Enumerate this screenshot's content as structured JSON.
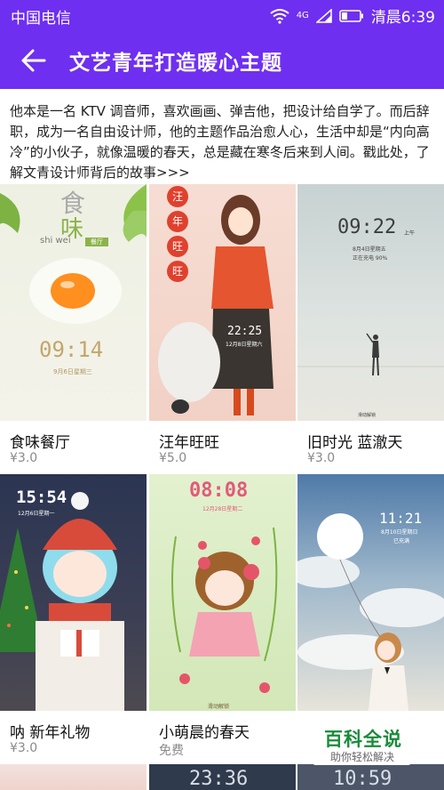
{
  "status_bar": {
    "carrier": "中国电信",
    "network": "4G",
    "time": "清晨6:39"
  },
  "header": {
    "title": "文艺青年打造暖心主题"
  },
  "description": "他本是一名 KTV 调音师，喜欢画画、弹吉他，把设计给自学了。而后辞职，成为一名自由设计师，他的主题作品治愈人心，生活中却是“内向高冷”的小伙子，就像温暖的春天，总是藏在寒冬后来到人间。戳此处，了解文青设计师背后的故事>>>",
  "themes": [
    {
      "name": "食味餐厅",
      "price": "¥3.0",
      "title_cn": "食",
      "title_cn2": "味",
      "title_pinyin": "shi wei",
      "badge": "餐厅",
      "clock": "09:14",
      "date": "9月6日星期三"
    },
    {
      "name": "汪年旺旺",
      "price": "¥5.0",
      "lantern": [
        "汪",
        "年",
        "旺",
        "旺"
      ],
      "clock": "22:25",
      "date": "12月8日星期六"
    },
    {
      "name": "旧时光 蓝澈天",
      "price": "¥3.0",
      "clock": "09:22",
      "ampm": "上午",
      "date": "8月4日星期五",
      "charge": "正在充电 90%",
      "unlock": "滑动解锁"
    },
    {
      "name": "呐 新年礼物",
      "price": "¥3.0",
      "clock": "15:54",
      "date": "12月6日星期一"
    },
    {
      "name": "小萌晨的春天",
      "price": "免费",
      "clock": "08:08",
      "date": "12月28日星期二",
      "unlock": "滑动解锁"
    },
    {
      "name": "",
      "price": "",
      "clock": "11:21",
      "date": "8月10日星期日",
      "weather": "已充满"
    }
  ],
  "bottom_row_clocks": [
    "23:36",
    "10:59"
  ],
  "watermark": {
    "title": "百科全说",
    "subtitle": "助你轻松解决"
  },
  "colors": {
    "accent": "#6f2ff0"
  }
}
